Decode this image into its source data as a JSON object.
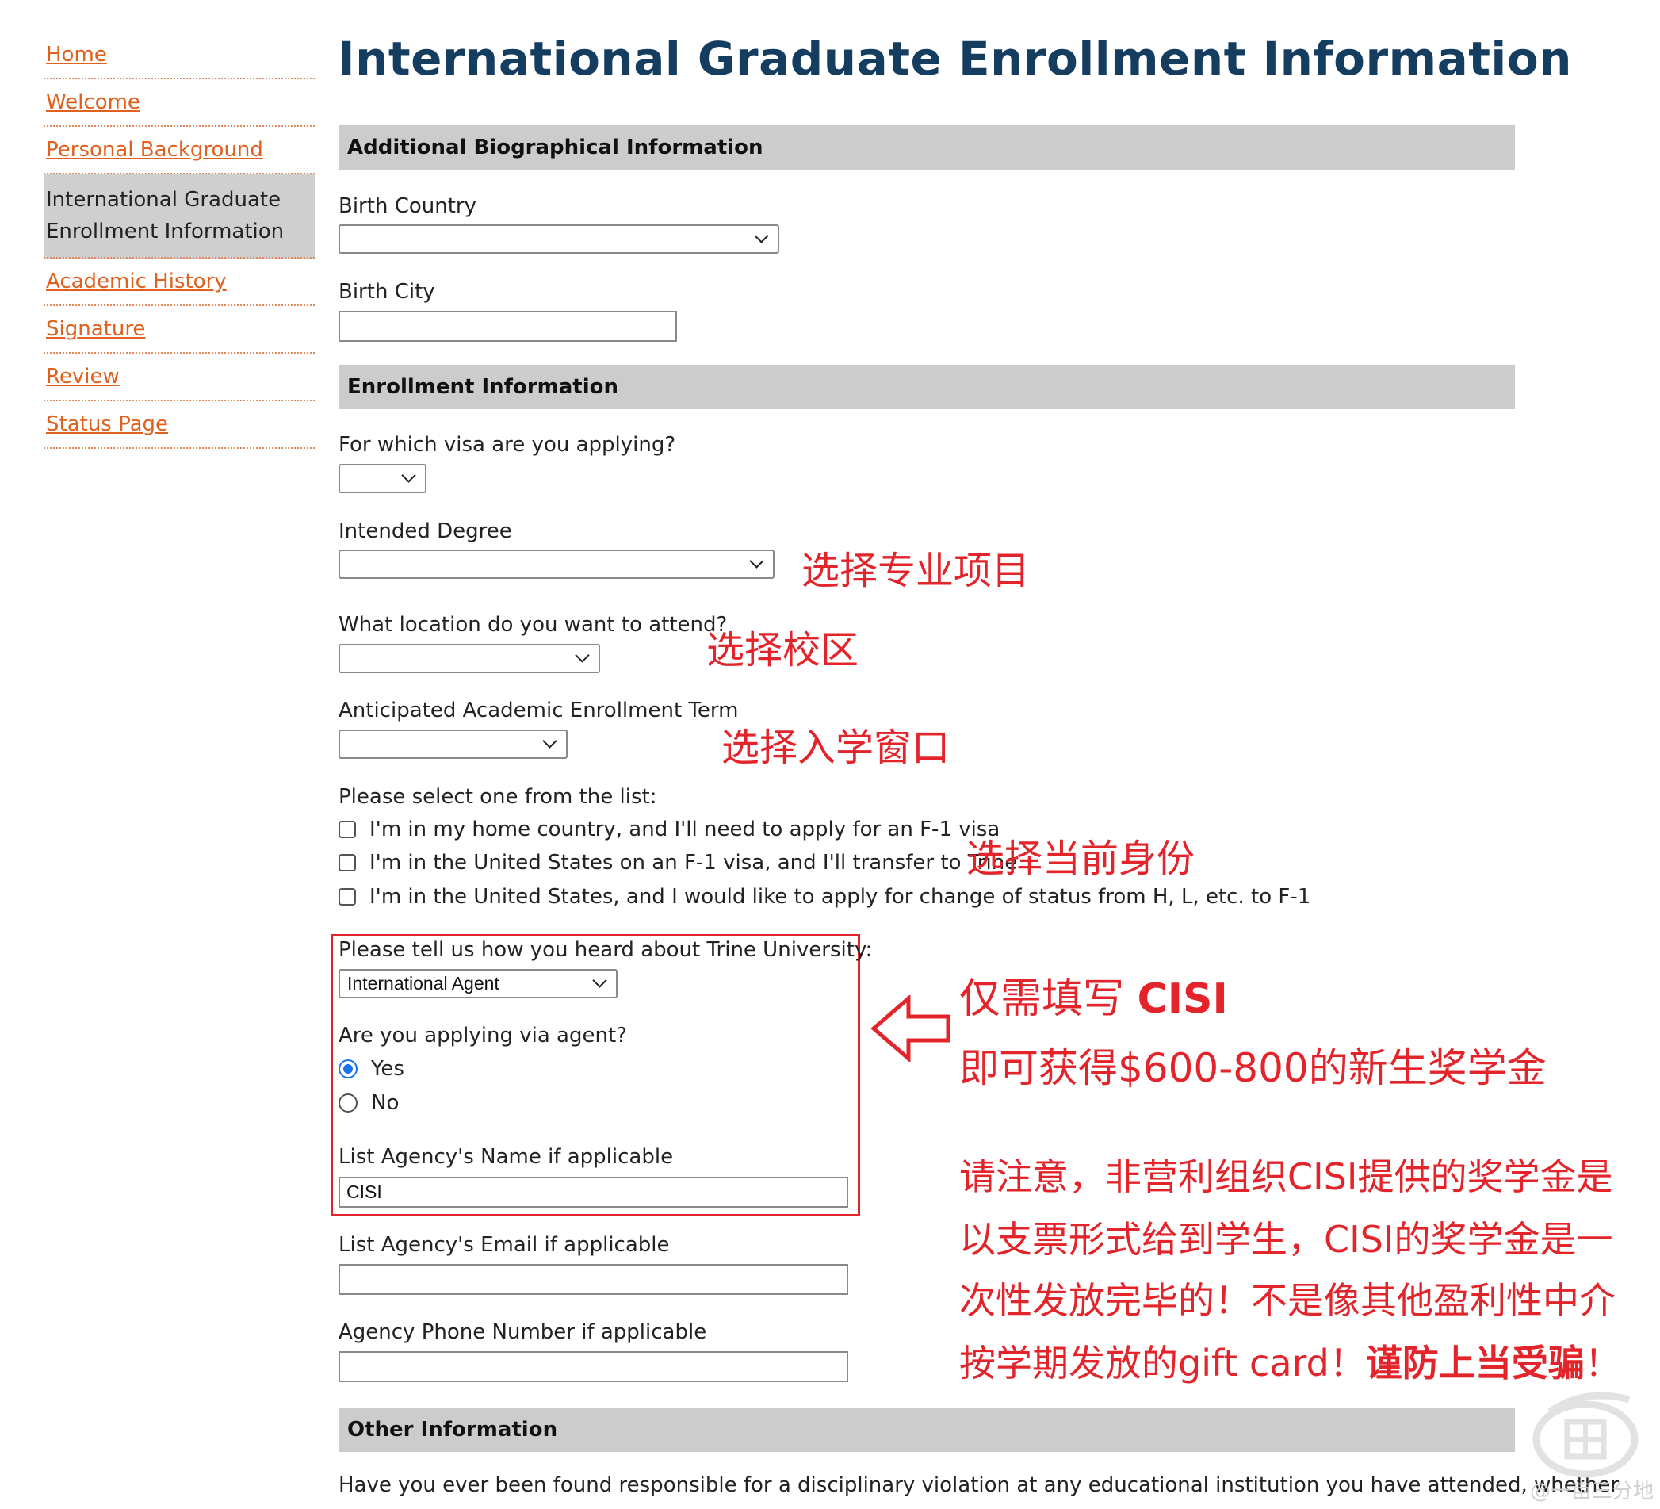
{
  "sidebar": {
    "items": [
      {
        "label": "Home"
      },
      {
        "label": "Welcome"
      },
      {
        "label": "Personal Background"
      },
      {
        "label_line1": "International Graduate",
        "label_line2": "Enrollment Information"
      },
      {
        "label": "Academic History"
      },
      {
        "label": "Signature"
      },
      {
        "label": "Review"
      },
      {
        "label": "Status Page"
      }
    ]
  },
  "page": {
    "title": "International Graduate Enrollment Information"
  },
  "sections": {
    "bio": "Additional Biographical Information",
    "enroll": "Enrollment Information",
    "other": "Other Information"
  },
  "fields": {
    "birth_country": {
      "label": "Birth Country",
      "value": ""
    },
    "birth_city": {
      "label": "Birth City",
      "value": ""
    },
    "visa": {
      "label": "For which visa are you applying?",
      "value": ""
    },
    "degree": {
      "label": "Intended Degree",
      "value": ""
    },
    "location": {
      "label": "What location do you want to attend?",
      "value": ""
    },
    "term": {
      "label": "Anticipated Academic Enrollment Term",
      "value": ""
    },
    "status_list": {
      "label": "Please select one from the list:",
      "options": [
        "I'm in my home country, and I'll need to apply for an F-1 visa",
        "I'm in the United States on an F-1 visa, and I'll transfer to Trine",
        "I'm in the United States, and I would like to apply for change of status from H, L, etc. to F-1"
      ]
    },
    "heard": {
      "label": "Please tell us how you heard about Trine University:",
      "value": "International Agent"
    },
    "via_agent": {
      "label": "Are you applying via agent?",
      "yes": "Yes",
      "no": "No",
      "selected": "Yes"
    },
    "agency_name": {
      "label": "List Agency's Name if applicable",
      "value": "CISI"
    },
    "agency_email": {
      "label": "List Agency's Email if applicable",
      "value": ""
    },
    "agency_phone": {
      "label": "Agency Phone Number if applicable",
      "value": ""
    },
    "disciplinary": {
      "label": "Have you ever been found responsible for a disciplinary violation at any educational institution you have attended, whether"
    }
  },
  "annotations": {
    "degree": "选择专业项目",
    "campus": "选择校区",
    "term": "选择入学窗口",
    "status": "选择当前身份",
    "cisi_prefix": "仅需填写 ",
    "cisi_bold": "CISI",
    "scholarship": "即可获得$600-800的新生奖学金",
    "note_line1": "请注意，非营利组织CISI提供的奖学金是",
    "note_line2": "以支票形式给到学生，CISI的奖学金是一",
    "note_line3": "次性发放完毕的！不是像其他盈利性中介",
    "note_line4": "按学期发放的gift card！",
    "note_bold": "谨防上当受骗",
    "note_end": "！"
  },
  "watermark": "@一亩三分地",
  "colors": {
    "accent_red": "#e3242b",
    "title_blue": "#143d60",
    "link_orange": "#e0601d"
  }
}
